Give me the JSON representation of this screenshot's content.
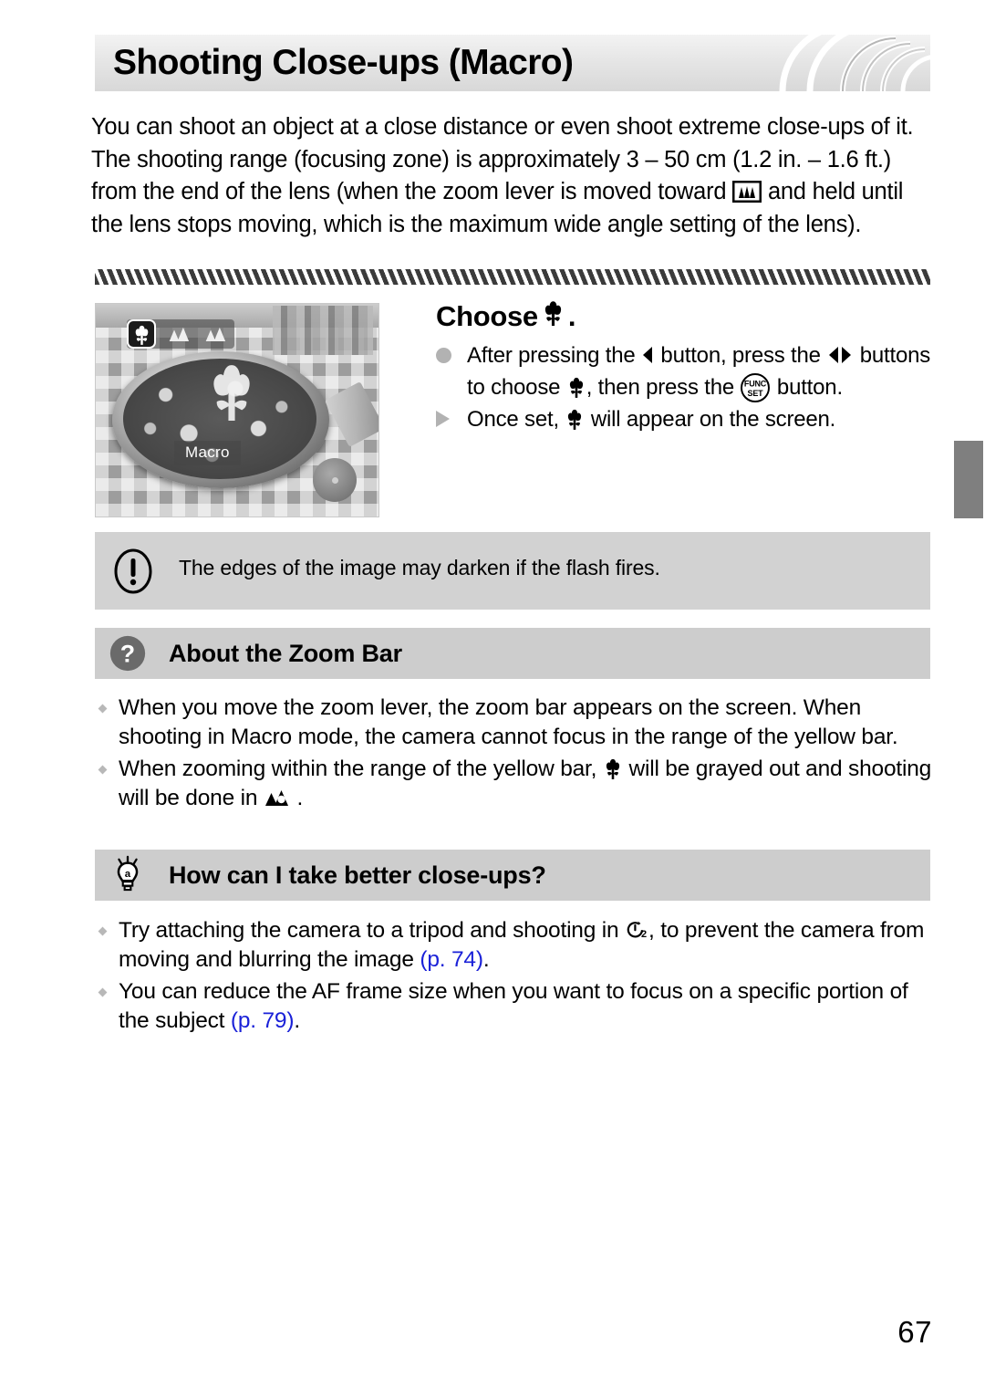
{
  "header": {
    "title": "Shooting Close-ups (Macro)"
  },
  "intro": {
    "part1": "You can shoot an object at a close distance or even shoot extreme close-ups of it. The shooting range (focusing zone) is approximately 3 – 50 cm (1.2 in. – 1.6 ft.) from the end of the lens (when the zoom lever is moved toward ",
    "icon": "wide-angle-zoom-icon",
    "part2": " and held until the lens stops moving, which is the maximum wide angle setting of the lens)."
  },
  "camera_screen": {
    "mode_label": "Macro",
    "selected_icon": "macro-tulip-icon",
    "other_icons": [
      "landscape-icon",
      "landscape-icon"
    ],
    "center_icon": "macro-tulip-icon"
  },
  "step": {
    "title_prefix": "Choose ",
    "title_icon": "macro-tulip-icon",
    "title_suffix": ".",
    "bullets": [
      {
        "marker": "circle",
        "seg1": "After pressing the ",
        "icon1": "arrow-left-icon",
        "seg2": " button, press the ",
        "icon2": "arrow-left-right-icon",
        "seg3": " buttons to choose ",
        "icon3": "macro-tulip-icon",
        "seg4": ", then press the ",
        "icon4": "func-set-button-icon",
        "seg5": " button."
      },
      {
        "marker": "triangle",
        "seg1": "Once set, ",
        "icon1": "macro-tulip-icon",
        "seg2": " will appear on the screen."
      }
    ]
  },
  "note": {
    "icon": "exclamation-icon",
    "text": "The edges of the image may darken if the flash fires."
  },
  "sections": [
    {
      "id": "zoom-bar",
      "icon": "question-mark-icon",
      "title": "About the Zoom Bar",
      "bullets": [
        {
          "seg1": "When you move the zoom lever, the zoom bar appears on the screen. When shooting in Macro mode, the camera cannot focus in the range of the yellow bar."
        },
        {
          "seg1": "When zooming within the range of the yellow bar, ",
          "icon1": "macro-tulip-icon",
          "seg2": " will be grayed out and shooting will be done in ",
          "icon2": "landscape-auto-icon",
          "seg3": " ."
        }
      ]
    },
    {
      "id": "better-closeups",
      "icon": "lightbulb-icon",
      "title": "How can I take better close-ups?",
      "bullets": [
        {
          "seg1": "Try attaching the camera to a tripod and shooting in ",
          "icon1": "self-timer-2sec-icon",
          "seg2": ", to prevent the camera from moving and blurring the image ",
          "pageref": "(p. 74)",
          "seg3": "."
        },
        {
          "seg1": "You can reduce the AF frame size when you want to focus on a specific portion of the subject ",
          "pageref": "(p. 79)",
          "seg2": "."
        }
      ]
    }
  ],
  "page_number": "67",
  "colors": {
    "page_reference_blue": "#1a21d8",
    "section_header_gray": "#cdcdcd",
    "note_box_gray": "#d2d2d2",
    "side_tab_gray": "#7f7f7f",
    "header_bar_gray": "#e4e4e4"
  }
}
